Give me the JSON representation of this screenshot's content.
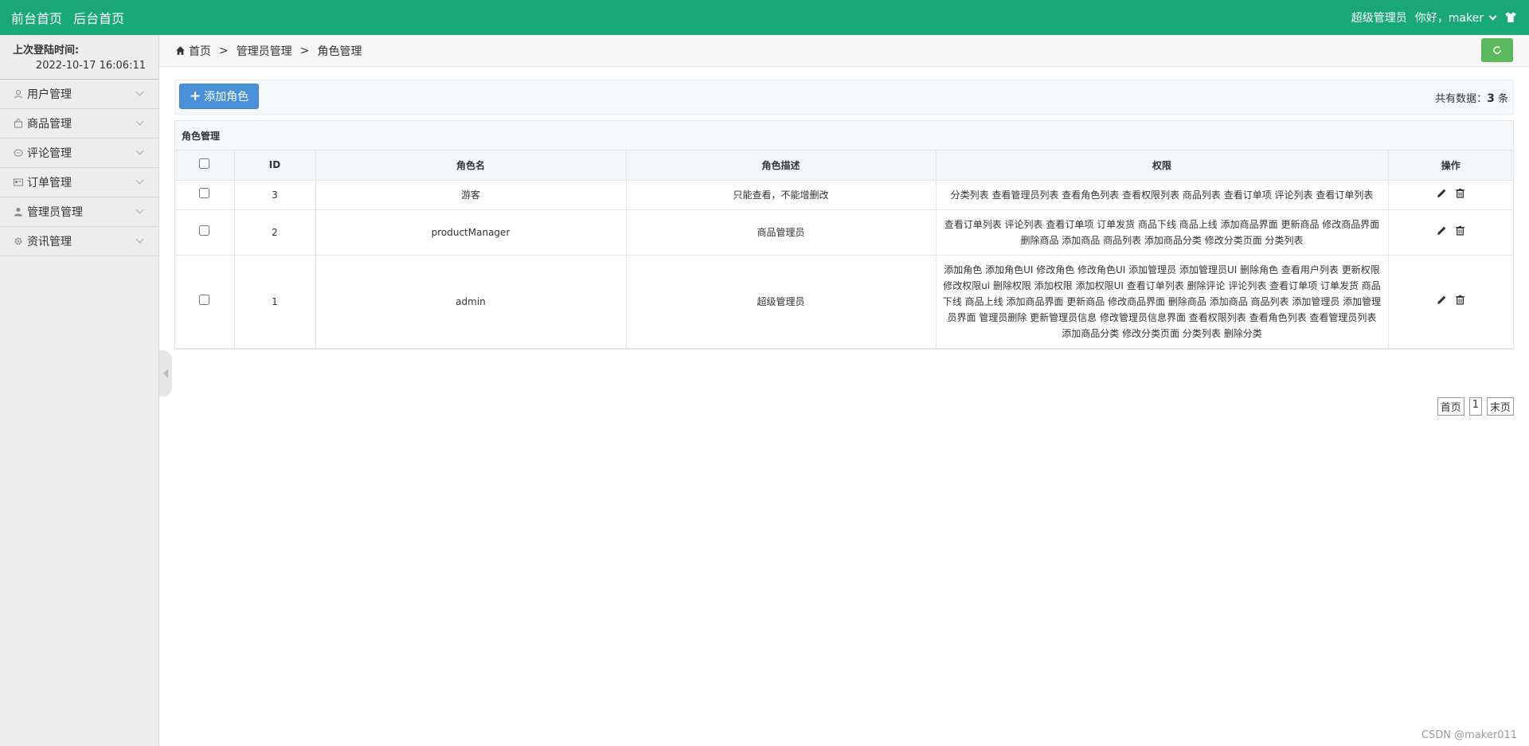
{
  "topbar": {
    "front_home": "前台首页",
    "back_home": "后台首页",
    "role": "超级管理员",
    "greeting": "你好，maker"
  },
  "sidebar": {
    "last_login_label": "上次登陆时间:",
    "last_login_value": "2022-10-17 16:06:11",
    "items": [
      {
        "label": "用户管理",
        "icon": "user-icon"
      },
      {
        "label": "商品管理",
        "icon": "bag-icon"
      },
      {
        "label": "评论管理",
        "icon": "comment-icon"
      },
      {
        "label": "订单管理",
        "icon": "order-icon"
      },
      {
        "label": "管理员管理",
        "icon": "admin-icon"
      },
      {
        "label": "资讯管理",
        "icon": "gear-icon"
      }
    ]
  },
  "breadcrumb": {
    "home": "首页",
    "sep": ">",
    "level1": "管理员管理",
    "level2": "角色管理"
  },
  "toolbar": {
    "add_label": "添加角色",
    "count_prefix": "共有数据：",
    "count_value": "3",
    "count_suffix": "条"
  },
  "panel": {
    "title": "角色管理",
    "headers": {
      "id": "ID",
      "name": "角色名",
      "desc": "角色描述",
      "perm": "权限",
      "op": "操作"
    },
    "rows": [
      {
        "id": "3",
        "name": "游客",
        "desc": "只能查看，不能增删改",
        "perm": "分类列表 查看管理员列表 查看角色列表 查看权限列表 商品列表 查看订单项 评论列表 查看订单列表"
      },
      {
        "id": "2",
        "name": "productManager",
        "desc": "商品管理员",
        "perm": "查看订单列表 评论列表 查看订单项 订单发货 商品下线 商品上线 添加商品界面 更新商品 修改商品界面 删除商品 添加商品 商品列表 添加商品分类 修改分类页面 分类列表"
      },
      {
        "id": "1",
        "name": "admin",
        "desc": "超级管理员",
        "perm": "添加角色 添加角色UI 修改角色 修改角色UI 添加管理员 添加管理员UI 删除角色 查看用户列表 更新权限 修改权限ui 删除权限 添加权限 添加权限UI 查看订单列表 删除评论 评论列表 查看订单项 订单发货 商品下线 商品上线 添加商品界面 更新商品 修改商品界面 删除商品 添加商品 商品列表 添加管理员 添加管理员界面 管理员删除 更新管理员信息 修改管理员信息界面 查看权限列表 查看角色列表 查看管理员列表 添加商品分类 修改分类页面 分类列表 删除分类"
      }
    ]
  },
  "pagination": {
    "first": "首页",
    "page": "1",
    "last": "末页"
  },
  "watermark": "CSDN @maker011",
  "colors": {
    "topbar": "#1aa77a",
    "add_button": "#4a90d9",
    "refresh_button": "#5cb85c"
  }
}
